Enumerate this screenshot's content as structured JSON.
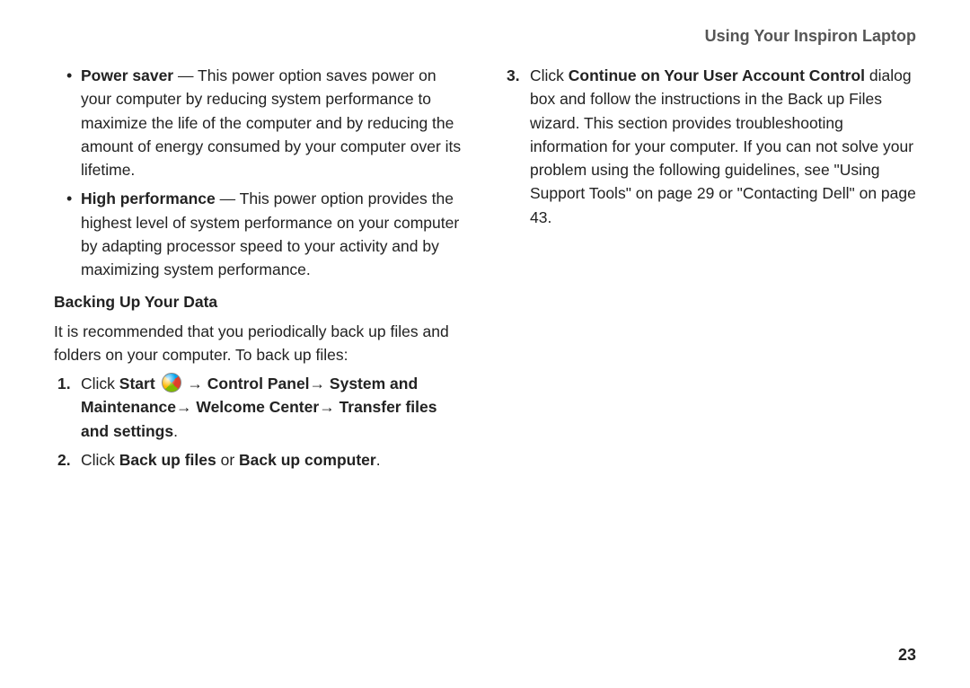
{
  "header": {
    "title": "Using Your Inspiron Laptop"
  },
  "left": {
    "powerSaver": {
      "label": "Power saver",
      "text": " — This power option saves power on your computer by reducing system performance to maximize the life of the computer and by reducing the amount of energy consumed by your computer over its lifetime."
    },
    "highPerf": {
      "label": "High performance",
      "text": " — This power option provides the highest level of system performance on your computer by adapting processor speed to your activity and by maximizing system performance."
    },
    "backupHeading": "Backing Up Your Data",
    "backupIntro": "It is recommended that you periodically back up files and folders on your computer. To back up files:",
    "step1": {
      "num": "1.",
      "pre": "Click ",
      "start": "Start",
      "arrow1": " → ",
      "path1": "Control Panel",
      "arrow2": "→ ",
      "path2": "System and Maintenance",
      "arrow3": "→ ",
      "path3": "Welcome Center",
      "arrow4": "→ ",
      "path4": "Transfer files and settings",
      "dot": "."
    },
    "step2": {
      "num": "2.",
      "pre": "Click ",
      "opt1": "Back up files",
      "or": " or ",
      "opt2": "Back up computer",
      "dot": "."
    }
  },
  "right": {
    "step3": {
      "num": "3.",
      "pre": "Click ",
      "bold": "Continue on Your User Account Control",
      "rest": " dialog box and follow the instructions in the Back up Files wizard. This section provides troubleshooting information for your computer. If you can not solve your problem using the following guidelines, see \"Using Support Tools\" on page 29 or \"Contacting Dell\" on page 43."
    }
  },
  "pageNumber": "23"
}
